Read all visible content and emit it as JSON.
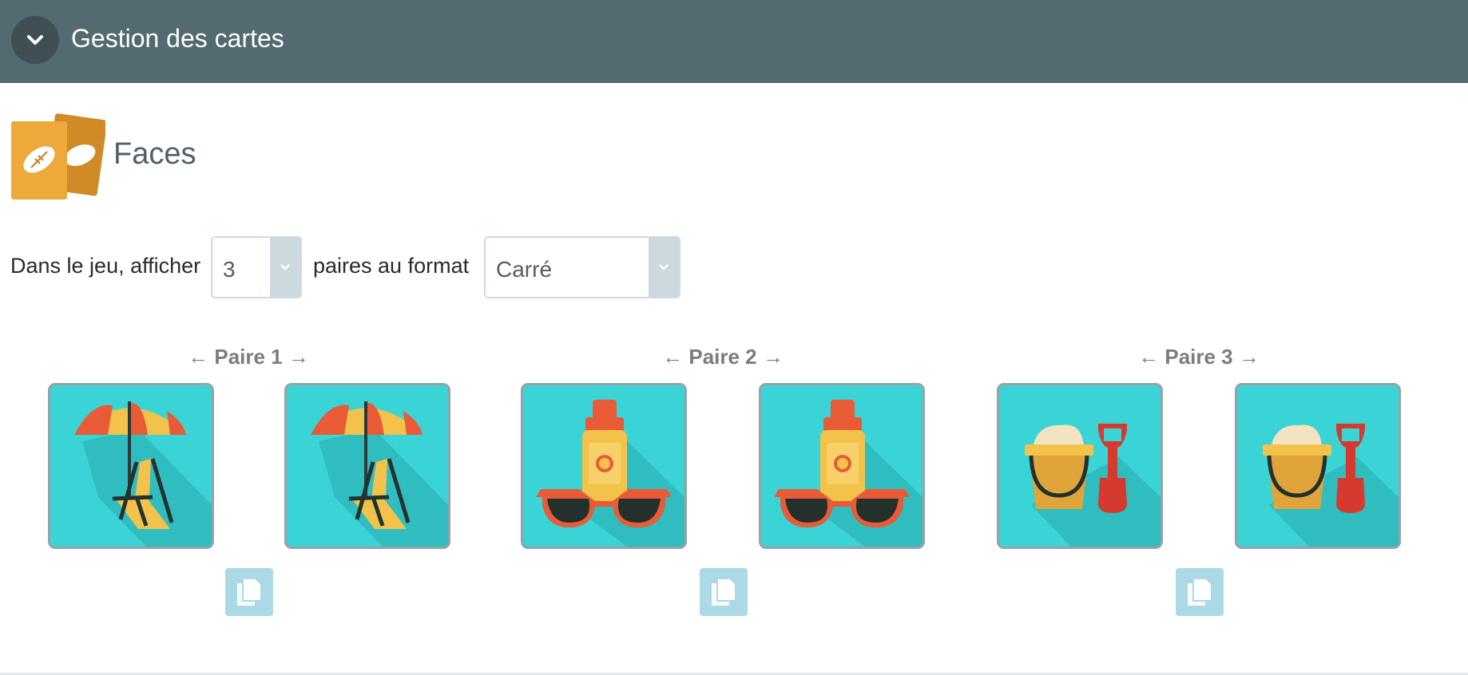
{
  "header": {
    "title": "Gestion des cartes",
    "toggle_icon": "chevron-down-icon"
  },
  "section": {
    "title": "Faces",
    "icon": "playing-cards-icon"
  },
  "settings": {
    "prefix": "Dans le jeu, afficher",
    "pairs_count": "3",
    "middle": "paires au format",
    "format": "Carré"
  },
  "pairs": [
    {
      "label": "← Paire 1 →",
      "image": "beach-umbrella-chair-icon"
    },
    {
      "label": "← Paire 2 →",
      "image": "sunscreen-sunglasses-icon"
    },
    {
      "label": "← Paire 3 →",
      "image": "sand-bucket-shovel-icon"
    }
  ],
  "colors": {
    "header": "#536a70",
    "card_bg": "#3ad4d6",
    "duplicate_button": "#acd9e6"
  }
}
